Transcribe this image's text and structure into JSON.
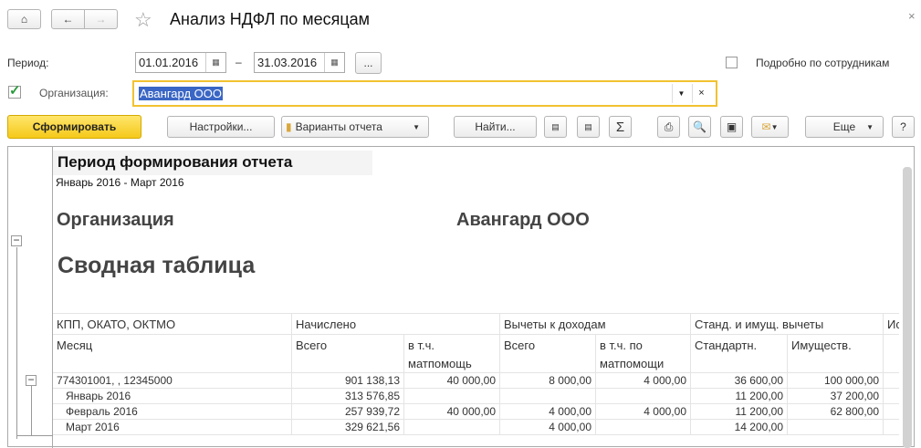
{
  "header": {
    "title": "Анализ НДФЛ по месяцам"
  },
  "form": {
    "period_label": "Период:",
    "date_from": "01.01.2016",
    "dash": "–",
    "date_to": "31.03.2016",
    "dots": "...",
    "detail_label": "Подробно по сотрудникам",
    "org_label": "Организация:",
    "org_value": "Авангард ООО",
    "org_checked": true
  },
  "toolbar": {
    "generate": "Сформировать",
    "settings": "Настройки...",
    "variants": "Варианты отчета",
    "find": "Найти...",
    "more": "Еще",
    "help": "?"
  },
  "report": {
    "period_title": "Период формирования отчета",
    "period_value": "Январь 2016 - Март 2016",
    "org_label": "Организация",
    "org_value": "Авангард ООО",
    "table_title": "Сводная таблица",
    "header1": [
      "КПП, ОКАТО, ОКТМО",
      "Начислено",
      "Вычеты к доходам",
      "Станд. и имущ. вычеты",
      "Ис"
    ],
    "header2": [
      "Месяц",
      "Всего",
      "в т.ч. матпомощь",
      "Всего",
      "в т.ч. по матпомощи",
      "Стандартн.",
      "Имуществ."
    ],
    "rows": [
      [
        "774301001, , 12345000",
        "901 138,13",
        "40 000,00",
        "8 000,00",
        "4 000,00",
        "36 600,00",
        "100 000,00"
      ],
      [
        "Январь 2016",
        "313 576,85",
        "",
        "",
        "",
        "11 200,00",
        "37 200,00"
      ],
      [
        "Февраль 2016",
        "257 939,72",
        "40 000,00",
        "4 000,00",
        "4 000,00",
        "11 200,00",
        "62 800,00"
      ],
      [
        "Март 2016",
        "329 621,56",
        "",
        "4 000,00",
        "",
        "14 200,00",
        ""
      ]
    ]
  }
}
